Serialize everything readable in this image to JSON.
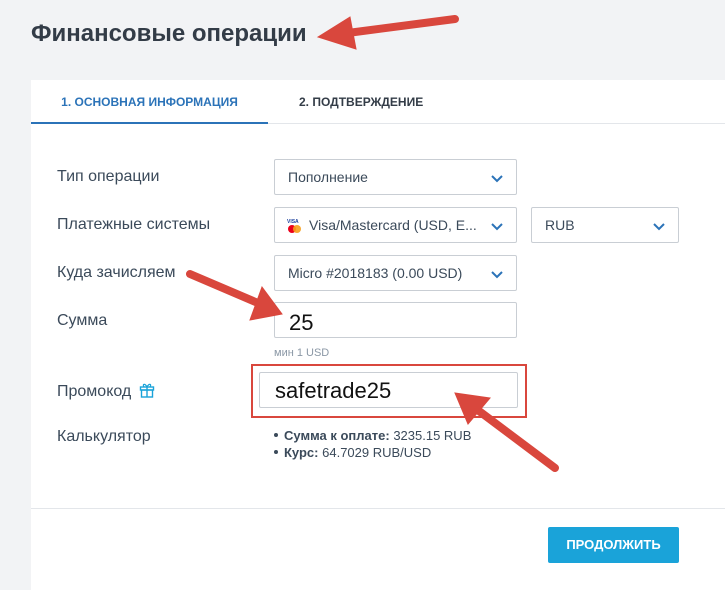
{
  "header": {
    "title": "Финансовые операции"
  },
  "tabs": [
    {
      "label": "1. Основная информация"
    },
    {
      "label": "2. Подтверждение"
    }
  ],
  "form": {
    "operation_type": {
      "label": "Тип операции",
      "value": "Пополнение"
    },
    "payment_system": {
      "label": "Платежные системы",
      "value": "Visa/Mastercard (USD, E...",
      "currency": "RUB"
    },
    "destination": {
      "label": "Куда зачисляем",
      "value": "Micro #2018183 (0.00 USD)"
    },
    "amount": {
      "label": "Сумма",
      "value": "25",
      "hint": "мин 1 USD"
    },
    "promo": {
      "label": "Промокод",
      "value": "safetrade25"
    },
    "calculator": {
      "label": "Калькулятор",
      "rows": [
        {
          "key": "Сумма к оплате:",
          "value": "3235.15 RUB"
        },
        {
          "key": "Курс:",
          "value": "64.7029 RUB/USD"
        }
      ]
    }
  },
  "actions": {
    "continue_label": "ПРОДОЛЖИТЬ"
  },
  "colors": {
    "accent": "#2b73b8",
    "button": "#1aa3d9",
    "annotation": "#d9473d"
  },
  "icons": [
    "gift-icon",
    "chevron-down-icon",
    "mastercard-icon"
  ]
}
